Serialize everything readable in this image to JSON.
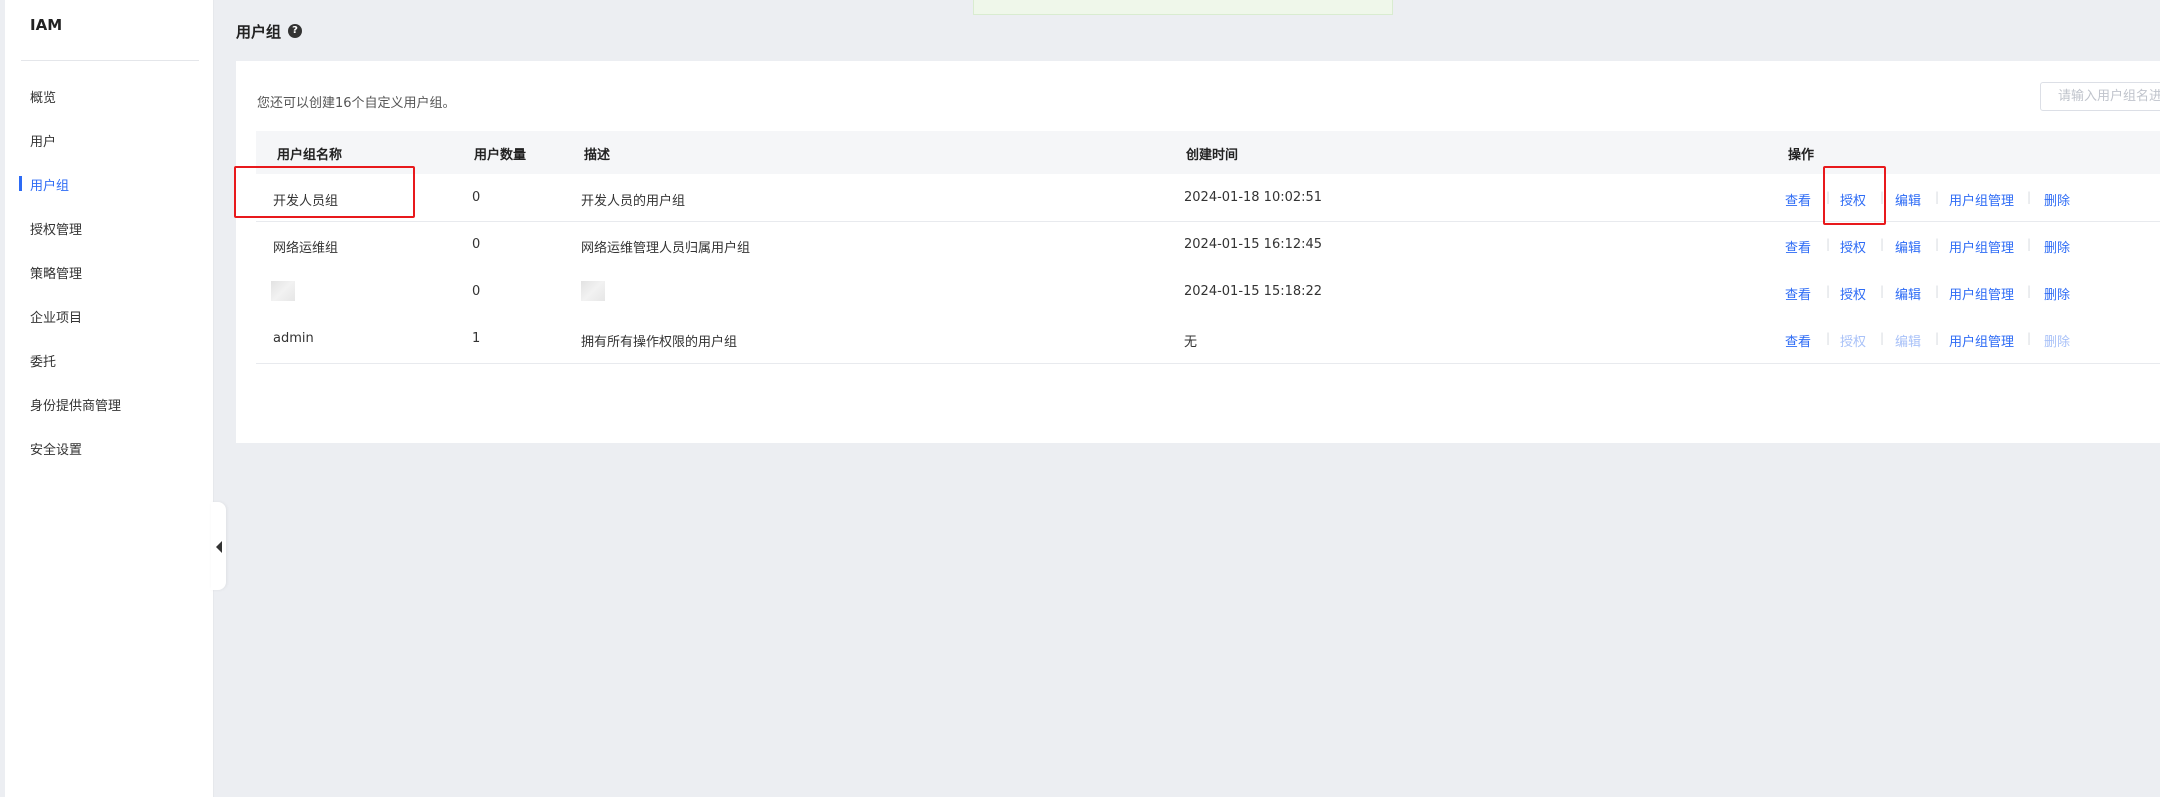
{
  "app": {
    "title": "IAM"
  },
  "sidebar": {
    "items": [
      {
        "label": "概览",
        "name": "overview"
      },
      {
        "label": "用户",
        "name": "users"
      },
      {
        "label": "用户组",
        "name": "user-groups",
        "active": true
      },
      {
        "label": "授权管理",
        "name": "authorization"
      },
      {
        "label": "策略管理",
        "name": "policy"
      },
      {
        "label": "企业项目",
        "name": "enterprise-projects"
      },
      {
        "label": "委托",
        "name": "agency"
      },
      {
        "label": "身份提供商管理",
        "name": "identity-providers"
      },
      {
        "label": "安全设置",
        "name": "security-settings"
      }
    ]
  },
  "page": {
    "title": "用户组",
    "help": "?"
  },
  "main": {
    "tip": "您还可以创建16个自定义用户组。",
    "search": {
      "placeholder": "请输入用户组名进行搜索"
    },
    "columns": [
      "用户组名称",
      "用户数量",
      "描述",
      "创建时间",
      "操作"
    ],
    "actions": [
      "查看",
      "授权",
      "编辑",
      "用户组管理",
      "删除"
    ],
    "rows": [
      {
        "name": "开发人员组",
        "count": "0",
        "desc": "开发人员的用户组",
        "created": "2024-01-18 10:02:51"
      },
      {
        "name": "网络运维组",
        "count": "0",
        "desc": "网络运维管理人员归属用户组",
        "created": "2024-01-15 16:12:45"
      },
      {
        "name": "",
        "count": "0",
        "desc": "",
        "created": "2024-01-15 15:18:22"
      },
      {
        "name": "admin",
        "count": "1",
        "desc": "拥有所有操作权限的用户组",
        "created": "无"
      }
    ]
  },
  "colors": {
    "accent": "#2d6bf5",
    "highlight": "#e8191c",
    "disabled_link": "#a8c1f8"
  },
  "icons": {
    "help": "help-icon",
    "collapse": "collapse-arrow-icon"
  }
}
